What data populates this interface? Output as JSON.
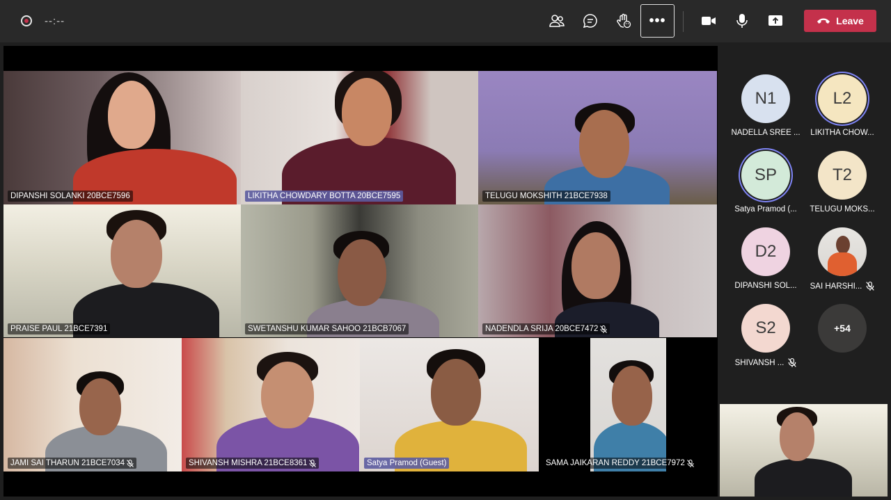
{
  "toolbar": {
    "timer": "--:--",
    "more_label": "•••",
    "leave_label": "Leave",
    "icons": [
      "record-icon",
      "people-icon",
      "chat-icon",
      "raise-hand-icon",
      "more-icon",
      "camera-icon",
      "mic-icon",
      "share-icon",
      "hangup-icon"
    ]
  },
  "stage": {
    "tiles": [
      {
        "name": "DIPANSHI SOLANKI   20BCE7596",
        "muted": false
      },
      {
        "name": "LIKITHA CHOWDARY BOTTA   20BCE7595",
        "muted": false,
        "highlight": true
      },
      {
        "name": "TELUGU MOKSHITH 21BCE7938",
        "muted": false
      },
      {
        "name": "PRAISE PAUL 21BCE7391",
        "muted": false
      },
      {
        "name": "SWETANSHU KUMAR SAHOO  21BCB7067",
        "muted": false
      },
      {
        "name": "NADENDLA SRIJA  20BCE7472",
        "muted": true
      },
      {
        "name": "JAMI SAI THARUN  21BCE7034",
        "muted": true
      },
      {
        "name": "SHIVANSH MISHRA 21BCE8361",
        "muted": true
      },
      {
        "name": "Satya Pramod (Guest)",
        "muted": false,
        "highlight": true
      },
      {
        "name": "SAMA JAIKARAN REDDY 21BCE7972",
        "muted": true
      }
    ]
  },
  "panel": {
    "participants": [
      {
        "initials": "N1",
        "name": "NADELLA SREE ...",
        "color": "#d8e1ef",
        "ring": false,
        "muted": false
      },
      {
        "initials": "L2",
        "name": "LIKITHA CHOW...",
        "color": "#f5e6c0",
        "ring": true,
        "muted": false
      },
      {
        "initials": "SP",
        "name": "Satya Pramod (...",
        "color": "#d3ead9",
        "ring": true,
        "muted": false
      },
      {
        "initials": "T2",
        "name": "TELUGU MOKS...",
        "color": "#f3e5c8",
        "ring": false,
        "muted": false
      },
      {
        "initials": "D2",
        "name": "DIPANSHI SOL...",
        "color": "#efd3e1",
        "ring": false,
        "muted": false
      },
      {
        "initials": "",
        "name": "SAI HARSHI...",
        "color": "#e9e9e9",
        "ring": false,
        "muted": true,
        "photo": true
      },
      {
        "initials": "S2",
        "name": "SHIVANSH ...",
        "color": "#f3d8d0",
        "ring": false,
        "muted": true
      }
    ],
    "overflow_count": "+54"
  }
}
